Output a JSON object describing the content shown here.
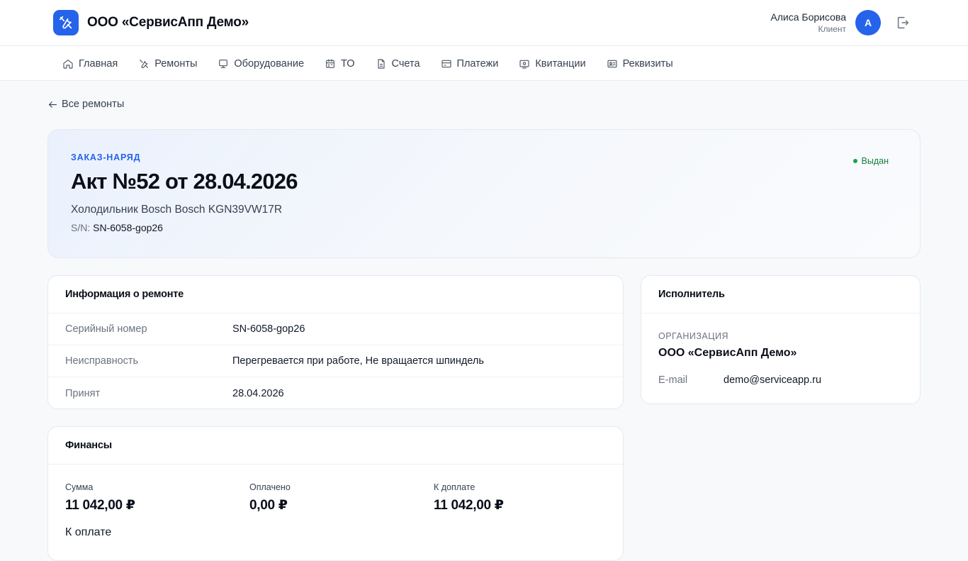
{
  "header": {
    "company": "ООО «СервисАпп Демо»",
    "user_name": "Алиса Борисова",
    "user_role": "Клиент",
    "avatar_letter": "А",
    "accent": "#2563eb"
  },
  "nav": {
    "items": [
      {
        "label": "Главная",
        "icon": "home-icon"
      },
      {
        "label": "Ремонты",
        "icon": "tools-icon"
      },
      {
        "label": "Оборудование",
        "icon": "monitor-icon"
      },
      {
        "label": "ТО",
        "icon": "calendar-icon"
      },
      {
        "label": "Счета",
        "icon": "document-icon"
      },
      {
        "label": "Платежи",
        "icon": "credit-card-icon"
      },
      {
        "label": "Квитанции",
        "icon": "receipt-icon"
      },
      {
        "label": "Реквизиты",
        "icon": "id-card-icon"
      }
    ]
  },
  "back_link": "Все ремонты",
  "order": {
    "kicker": "ЗАКАЗ-НАРЯД",
    "title": "Акт №52 от 28.04.2026",
    "device": "Холодильник Bosch Bosch KGN39VW17R",
    "sn_label": "S/N:",
    "sn_value": "SN-6058-gop26",
    "status": "Выдан",
    "status_color": "#16a34a"
  },
  "repair_info": {
    "title": "Информация о ремонте",
    "rows": [
      {
        "key": "Серийный номер",
        "value": "SN-6058-gop26"
      },
      {
        "key": "Неисправность",
        "value": "Перегревается при работе, Не вращается шпиндель"
      },
      {
        "key": "Принят",
        "value": "28.04.2026"
      }
    ]
  },
  "executor": {
    "title": "Исполнитель",
    "org_label": "ОРГАНИЗАЦИЯ",
    "org_name": "ООО «СервисАпп Демо»",
    "email_label": "E-mail",
    "email_value": "demo@serviceapp.ru"
  },
  "finance": {
    "title": "Финансы",
    "sum_label": "Сумма",
    "sum_value": "11 042,00 ₽",
    "paid_label": "Оплачено",
    "paid_value": "0,00 ₽",
    "due_label": "К доплате",
    "due_value": "11 042,00 ₽",
    "pay_label": "К оплате"
  }
}
